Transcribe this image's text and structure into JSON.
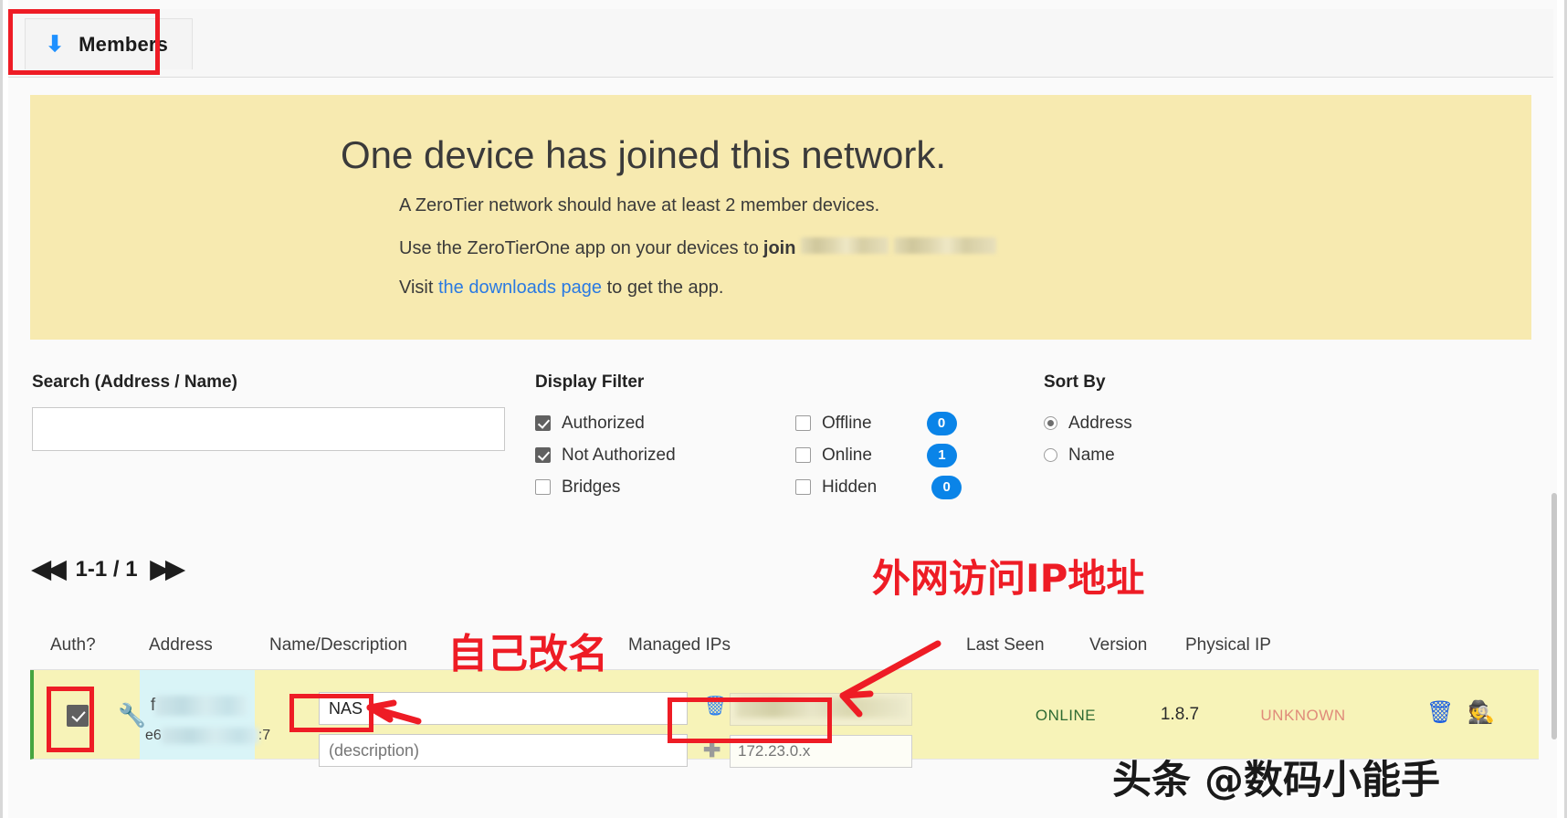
{
  "tab": {
    "label": "Members",
    "icon": "up-arrow-icon"
  },
  "banner": {
    "heading": "One device has joined this network.",
    "line1": "A ZeroTier network should have at least 2 member devices.",
    "line2_prefix": "Use the ZeroTierOne app on your devices to",
    "line2_bold": "join",
    "line2_redacted": "",
    "line3_prefix": "Visit",
    "line3_link": "the downloads page",
    "line3_suffix": "to get the app."
  },
  "search": {
    "label": "Search (Address / Name)",
    "value": "",
    "placeholder": ""
  },
  "display_filter": {
    "label": "Display Filter",
    "left": [
      {
        "label": "Authorized",
        "checked": true
      },
      {
        "label": "Not Authorized",
        "checked": true
      },
      {
        "label": "Bridges",
        "checked": false
      }
    ],
    "right": [
      {
        "label": "Offline",
        "checked": false,
        "count": "0"
      },
      {
        "label": "Online",
        "checked": false,
        "count": "1"
      },
      {
        "label": "Hidden",
        "checked": false,
        "count": "0"
      }
    ]
  },
  "sort_by": {
    "label": "Sort By",
    "options": [
      {
        "label": "Address",
        "selected": true
      },
      {
        "label": "Name",
        "selected": false
      }
    ]
  },
  "pager": {
    "first": "◀◀",
    "range": "1-1 / 1",
    "last": "▶▶"
  },
  "table": {
    "headers": {
      "auth": "Auth?",
      "address": "Address",
      "name_desc": "Name/Description",
      "managed_ips": "Managed IPs",
      "last_seen": "Last Seen",
      "version": "Version",
      "physical_ip": "Physical IP"
    },
    "row": {
      "authorized": true,
      "wrench_icon": "wrench-icon",
      "address_visible_prefix": "f",
      "address_line2_prefix": "e6",
      "address_line2_suffix": ":7",
      "name_value": "NAS",
      "description_placeholder": "(description)",
      "ip_delete_icon": "trash-icon",
      "ip_add_icon": "plus-icon",
      "ip_new_placeholder": "172.23.0.x",
      "last_seen": "ONLINE",
      "version": "1.8.7",
      "physical_ip": "UNKNOWN",
      "delete_icon": "trash-icon",
      "hide_icon": "eye-slash-icon"
    }
  },
  "annotations": {
    "rename": "自己改名",
    "wan_ip": "外网访问IP地址"
  },
  "watermark": "头条 @数码小能手",
  "colors": {
    "banner_bg": "#f7eab0",
    "row_bg": "#f7f3b8",
    "accent_blue": "#0a84e8",
    "annotation_red": "#ee1c25",
    "online_green": "#2f6b33",
    "unknown_salmon": "#e08b7a"
  }
}
